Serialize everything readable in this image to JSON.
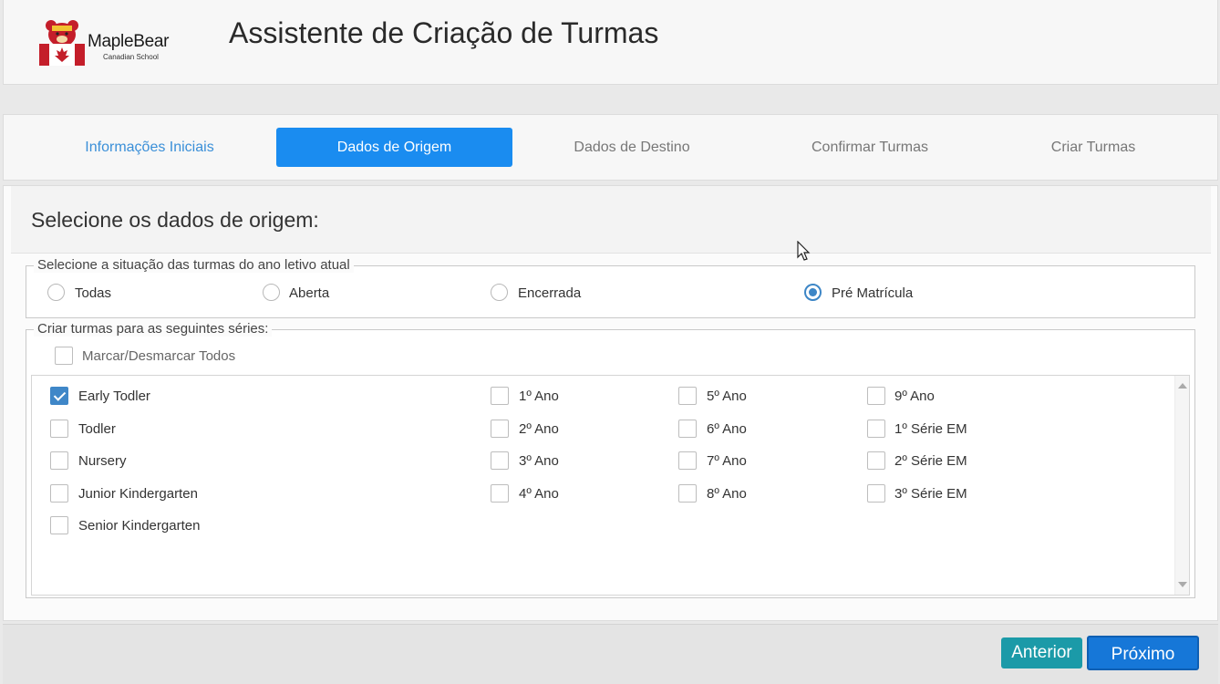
{
  "header": {
    "logo_text": "MapleBear",
    "logo_subtext": "Canadian School",
    "title": "Assistente de Criação de Turmas"
  },
  "steps": [
    {
      "label": "Informações Iniciais",
      "state": "done"
    },
    {
      "label": "Dados de Origem",
      "state": "active"
    },
    {
      "label": "Dados de Destino",
      "state": "pending"
    },
    {
      "label": "Confirmar Turmas",
      "state": "pending"
    },
    {
      "label": "Criar Turmas",
      "state": "pending"
    }
  ],
  "panel": {
    "title": "Selecione os dados de origem:"
  },
  "situation": {
    "legend": "Selecione a situação das turmas do ano letivo atual",
    "options": [
      {
        "label": "Todas",
        "selected": false
      },
      {
        "label": "Aberta",
        "selected": false
      },
      {
        "label": "Encerrada",
        "selected": false
      },
      {
        "label": "Pré Matrícula",
        "selected": true
      }
    ]
  },
  "series": {
    "legend": "Criar turmas para as seguintes séries:",
    "toggle_all_label": "Marcar/Desmarcar Todos",
    "columns": [
      [
        {
          "label": "Early Todler",
          "checked": true
        },
        {
          "label": "Todler",
          "checked": false
        },
        {
          "label": "Nursery",
          "checked": false
        },
        {
          "label": "Junior Kindergarten",
          "checked": false
        },
        {
          "label": "Senior Kindergarten",
          "checked": false
        }
      ],
      [
        {
          "label": "1º Ano",
          "checked": false
        },
        {
          "label": "2º Ano",
          "checked": false
        },
        {
          "label": "3º Ano",
          "checked": false
        },
        {
          "label": "4º Ano",
          "checked": false
        }
      ],
      [
        {
          "label": "5º Ano",
          "checked": false
        },
        {
          "label": "6º Ano",
          "checked": false
        },
        {
          "label": "7º Ano",
          "checked": false
        },
        {
          "label": "8º Ano",
          "checked": false
        }
      ],
      [
        {
          "label": "9º Ano",
          "checked": false
        },
        {
          "label": "1º Série EM",
          "checked": false
        },
        {
          "label": "2º Série EM",
          "checked": false
        },
        {
          "label": "3º Série EM",
          "checked": false
        }
      ]
    ]
  },
  "footer": {
    "prev_label": "Anterior",
    "next_label": "Próximo"
  },
  "colors": {
    "accent": "#1a8cf0",
    "checkbox_checked": "#3f87c8",
    "prev_button": "#1b9aa8",
    "next_button": "#1677d8"
  }
}
